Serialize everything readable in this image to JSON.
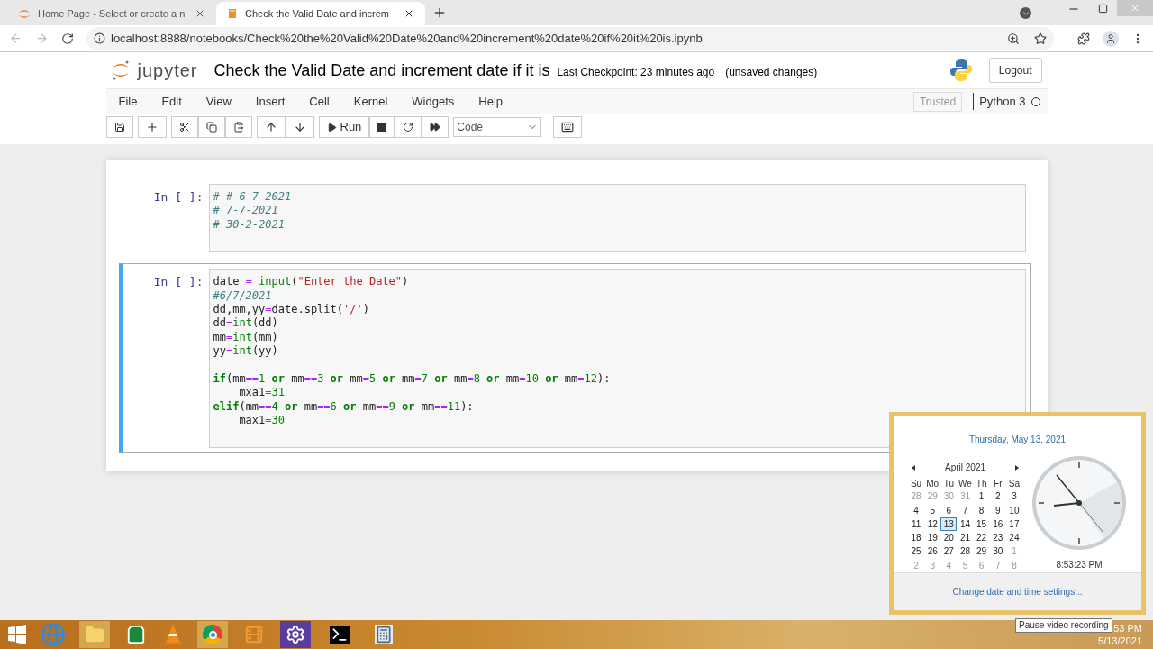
{
  "browser": {
    "tabs": [
      {
        "title": "Home Page - Select or create a n",
        "selected": false
      },
      {
        "title": "Check the Valid Date and increm",
        "selected": true
      }
    ],
    "url": "localhost:8888/notebooks/Check%20the%20Valid%20Date%20and%20increment%20date%20if%20it%20is.ipynb"
  },
  "notebook": {
    "logo": "jupyter",
    "title": "Check the Valid Date and increment date if it is",
    "checkpoint": "Last Checkpoint: 23 minutes ago",
    "status": "(unsaved changes)",
    "logout": "Logout",
    "menu": [
      "File",
      "Edit",
      "View",
      "Insert",
      "Cell",
      "Kernel",
      "Widgets",
      "Help"
    ],
    "trusted": "Trusted",
    "kernel": "Python 3",
    "run_label": "Run",
    "cell_type": "Code",
    "cells": [
      {
        "prompt": "In [ ]:",
        "selected": false,
        "lines": [
          {
            "kind": "code",
            "tokens": [
              {
                "kind": "cm",
                "text": "# # 6-7-2021"
              }
            ]
          },
          {
            "kind": "code",
            "tokens": [
              {
                "kind": "cm",
                "text": "# 7-7-2021"
              }
            ]
          },
          {
            "kind": "code",
            "tokens": [
              {
                "kind": "cm",
                "text": "# 30-2-2021"
              }
            ]
          }
        ]
      },
      {
        "prompt": "In [ ]:",
        "selected": true,
        "lines": [
          {
            "kind": "code",
            "tokens": [
              {
                "kind": "txt",
                "text": "date "
              },
              {
                "kind": "op",
                "text": "= "
              },
              {
                "kind": "bi",
                "text": "input"
              },
              {
                "kind": "txt",
                "text": "("
              },
              {
                "kind": "str",
                "text": "\"Enter the Date\""
              },
              {
                "kind": "txt",
                "text": ")"
              }
            ]
          },
          {
            "kind": "code",
            "tokens": [
              {
                "kind": "cm",
                "text": "#6/7/2021"
              }
            ]
          },
          {
            "kind": "code",
            "tokens": [
              {
                "kind": "txt",
                "text": "dd,mm,yy"
              },
              {
                "kind": "op",
                "text": "="
              },
              {
                "kind": "txt",
                "text": "date.split("
              },
              {
                "kind": "str",
                "text": "'/'"
              },
              {
                "kind": "txt",
                "text": ")"
              }
            ]
          },
          {
            "kind": "code",
            "tokens": [
              {
                "kind": "txt",
                "text": "dd"
              },
              {
                "kind": "op",
                "text": "="
              },
              {
                "kind": "bi",
                "text": "int"
              },
              {
                "kind": "txt",
                "text": "(dd)"
              }
            ]
          },
          {
            "kind": "code",
            "tokens": [
              {
                "kind": "txt",
                "text": "mm"
              },
              {
                "kind": "op",
                "text": "="
              },
              {
                "kind": "bi",
                "text": "int"
              },
              {
                "kind": "txt",
                "text": "(mm)"
              }
            ]
          },
          {
            "kind": "code",
            "tokens": [
              {
                "kind": "txt",
                "text": "yy"
              },
              {
                "kind": "op",
                "text": "="
              },
              {
                "kind": "bi",
                "text": "int"
              },
              {
                "kind": "txt",
                "text": "(yy)"
              }
            ]
          },
          {
            "kind": "blank"
          },
          {
            "kind": "code",
            "tokens": [
              {
                "kind": "kw",
                "text": "if"
              },
              {
                "kind": "txt",
                "text": "(mm"
              },
              {
                "kind": "op",
                "text": "=="
              },
              {
                "kind": "num",
                "text": "1 "
              },
              {
                "kind": "kw",
                "text": "or"
              },
              {
                "kind": "txt",
                "text": " mm"
              },
              {
                "kind": "op",
                "text": "=="
              },
              {
                "kind": "num",
                "text": "3 "
              },
              {
                "kind": "kw",
                "text": "or"
              },
              {
                "kind": "txt",
                "text": " mm"
              },
              {
                "kind": "op",
                "text": "="
              },
              {
                "kind": "num",
                "text": "5 "
              },
              {
                "kind": "kw",
                "text": "or"
              },
              {
                "kind": "txt",
                "text": " mm"
              },
              {
                "kind": "op",
                "text": "="
              },
              {
                "kind": "num",
                "text": "7 "
              },
              {
                "kind": "kw",
                "text": "or"
              },
              {
                "kind": "txt",
                "text": " mm"
              },
              {
                "kind": "op",
                "text": "="
              },
              {
                "kind": "num",
                "text": "8 "
              },
              {
                "kind": "kw",
                "text": "or"
              },
              {
                "kind": "txt",
                "text": " mm"
              },
              {
                "kind": "op",
                "text": "="
              },
              {
                "kind": "num",
                "text": "10 "
              },
              {
                "kind": "kw",
                "text": "or"
              },
              {
                "kind": "txt",
                "text": " mm"
              },
              {
                "kind": "op",
                "text": "="
              },
              {
                "kind": "num",
                "text": "12"
              },
              {
                "kind": "txt",
                "text": "):"
              }
            ]
          },
          {
            "kind": "code",
            "tokens": [
              {
                "kind": "txt",
                "text": "    mxa1"
              },
              {
                "kind": "op",
                "text": "="
              },
              {
                "kind": "num",
                "text": "31"
              }
            ]
          },
          {
            "kind": "code",
            "tokens": [
              {
                "kind": "kw",
                "text": "elif"
              },
              {
                "kind": "txt",
                "text": "(mm"
              },
              {
                "kind": "op",
                "text": "=="
              },
              {
                "kind": "num",
                "text": "4 "
              },
              {
                "kind": "kw",
                "text": "or"
              },
              {
                "kind": "txt",
                "text": " mm"
              },
              {
                "kind": "op",
                "text": "=="
              },
              {
                "kind": "num",
                "text": "6 "
              },
              {
                "kind": "kw",
                "text": "or"
              },
              {
                "kind": "txt",
                "text": " mm"
              },
              {
                "kind": "op",
                "text": "=="
              },
              {
                "kind": "num",
                "text": "9 "
              },
              {
                "kind": "kw",
                "text": "or"
              },
              {
                "kind": "txt",
                "text": " mm"
              },
              {
                "kind": "op",
                "text": "=="
              },
              {
                "kind": "num",
                "text": "11"
              },
              {
                "kind": "txt",
                "text": "):"
              }
            ]
          },
          {
            "kind": "code",
            "tokens": [
              {
                "kind": "txt",
                "text": "    max1"
              },
              {
                "kind": "op",
                "text": "="
              },
              {
                "kind": "num",
                "text": "30"
              }
            ]
          }
        ]
      }
    ]
  },
  "calendar": {
    "long_date": "Thursday, May 13, 2021",
    "month": "April 2021",
    "weekdays": [
      "Su",
      "Mo",
      "Tu",
      "We",
      "Th",
      "Fr",
      "Sa"
    ],
    "days": [
      {
        "text": "28",
        "muted": true,
        "selected": false
      },
      {
        "text": "29",
        "muted": true,
        "selected": false
      },
      {
        "text": "30",
        "muted": true,
        "selected": false
      },
      {
        "text": "31",
        "muted": true,
        "selected": false
      },
      {
        "text": "1",
        "muted": false,
        "selected": false
      },
      {
        "text": "2",
        "muted": false,
        "selected": false
      },
      {
        "text": "3",
        "muted": false,
        "selected": false
      },
      {
        "text": "4",
        "muted": false,
        "selected": false
      },
      {
        "text": "5",
        "muted": false,
        "selected": false
      },
      {
        "text": "6",
        "muted": false,
        "selected": false
      },
      {
        "text": "7",
        "muted": false,
        "selected": false
      },
      {
        "text": "8",
        "muted": false,
        "selected": false
      },
      {
        "text": "9",
        "muted": false,
        "selected": false
      },
      {
        "text": "10",
        "muted": false,
        "selected": false
      },
      {
        "text": "11",
        "muted": false,
        "selected": false
      },
      {
        "text": "12",
        "muted": false,
        "selected": false
      },
      {
        "text": "13",
        "muted": false,
        "selected": true
      },
      {
        "text": "14",
        "muted": false,
        "selected": false
      },
      {
        "text": "15",
        "muted": false,
        "selected": false
      },
      {
        "text": "16",
        "muted": false,
        "selected": false
      },
      {
        "text": "17",
        "muted": false,
        "selected": false
      },
      {
        "text": "18",
        "muted": false,
        "selected": false
      },
      {
        "text": "19",
        "muted": false,
        "selected": false
      },
      {
        "text": "20",
        "muted": false,
        "selected": false
      },
      {
        "text": "21",
        "muted": false,
        "selected": false
      },
      {
        "text": "22",
        "muted": false,
        "selected": false
      },
      {
        "text": "23",
        "muted": false,
        "selected": false
      },
      {
        "text": "24",
        "muted": false,
        "selected": false
      },
      {
        "text": "25",
        "muted": false,
        "selected": false
      },
      {
        "text": "26",
        "muted": false,
        "selected": false
      },
      {
        "text": "27",
        "muted": false,
        "selected": false
      },
      {
        "text": "28",
        "muted": false,
        "selected": false
      },
      {
        "text": "29",
        "muted": false,
        "selected": false
      },
      {
        "text": "30",
        "muted": false,
        "selected": false
      },
      {
        "text": "1",
        "muted": true,
        "selected": false
      },
      {
        "text": "2",
        "muted": true,
        "selected": false
      },
      {
        "text": "3",
        "muted": true,
        "selected": false
      },
      {
        "text": "4",
        "muted": true,
        "selected": false
      },
      {
        "text": "5",
        "muted": true,
        "selected": false
      },
      {
        "text": "6",
        "muted": true,
        "selected": false
      },
      {
        "text": "7",
        "muted": true,
        "selected": false
      },
      {
        "text": "8",
        "muted": true,
        "selected": false
      }
    ],
    "time": "8:53:23 PM",
    "settings_link": "Change date and time settings..."
  },
  "taskbar": {
    "tooltip": "Pause video recording",
    "time": "53 PM",
    "date": "5/13/2021"
  }
}
